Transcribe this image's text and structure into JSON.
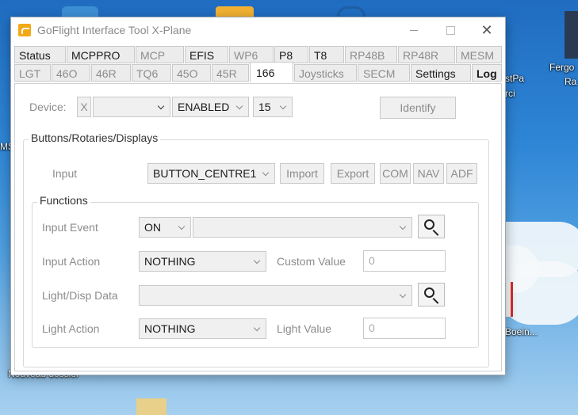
{
  "desktop": {
    "labels": {
      "fergo": "Fergo",
      "ra": "Ra",
      "stpa": "stPa",
      "rci": "rci",
      "ms": "MS",
      "boein": "Boein...",
      "nouveau": "Nouveau dossier"
    }
  },
  "window": {
    "title": "GoFlight Interface Tool X-Plane",
    "controls": {
      "close": "✕"
    }
  },
  "tabs_row1": [
    "Status",
    "MCPPRO",
    "MCP",
    "EFIS",
    "WP6",
    "P8",
    "T8",
    "RP48B",
    "RP48R",
    "MESM"
  ],
  "tabs_row2": [
    "LGT",
    "46O",
    "46R",
    "TQ6",
    "45O",
    "45R",
    "166",
    "Joysticks",
    "SECM",
    "Settings",
    "Log"
  ],
  "active_tab": "166",
  "device": {
    "label": "Device:",
    "x_value": "X",
    "dropdown_value": "",
    "status_value": "ENABLED",
    "number_value": "15",
    "identify_label": "Identify"
  },
  "buttons_group": {
    "title": "Buttons/Rotaries/Displays",
    "input_label": "Input",
    "input_value": "BUTTON_CENTRE1",
    "import_label": "Import",
    "export_label": "Export",
    "com_label": "COM",
    "nav_label": "NAV",
    "adf_label": "ADF"
  },
  "functions_group": {
    "title": "Functions",
    "input_event_label": "Input Event",
    "input_event_value": "ON",
    "input_action_label": "Input Action",
    "input_action_value": "NOTHING",
    "custom_value_label": "Custom Value",
    "custom_value": "0",
    "light_disp_label": "Light/Disp Data",
    "light_action_label": "Light Action",
    "light_action_value": "NOTHING",
    "light_value_label": "Light Value",
    "light_value": "0"
  }
}
